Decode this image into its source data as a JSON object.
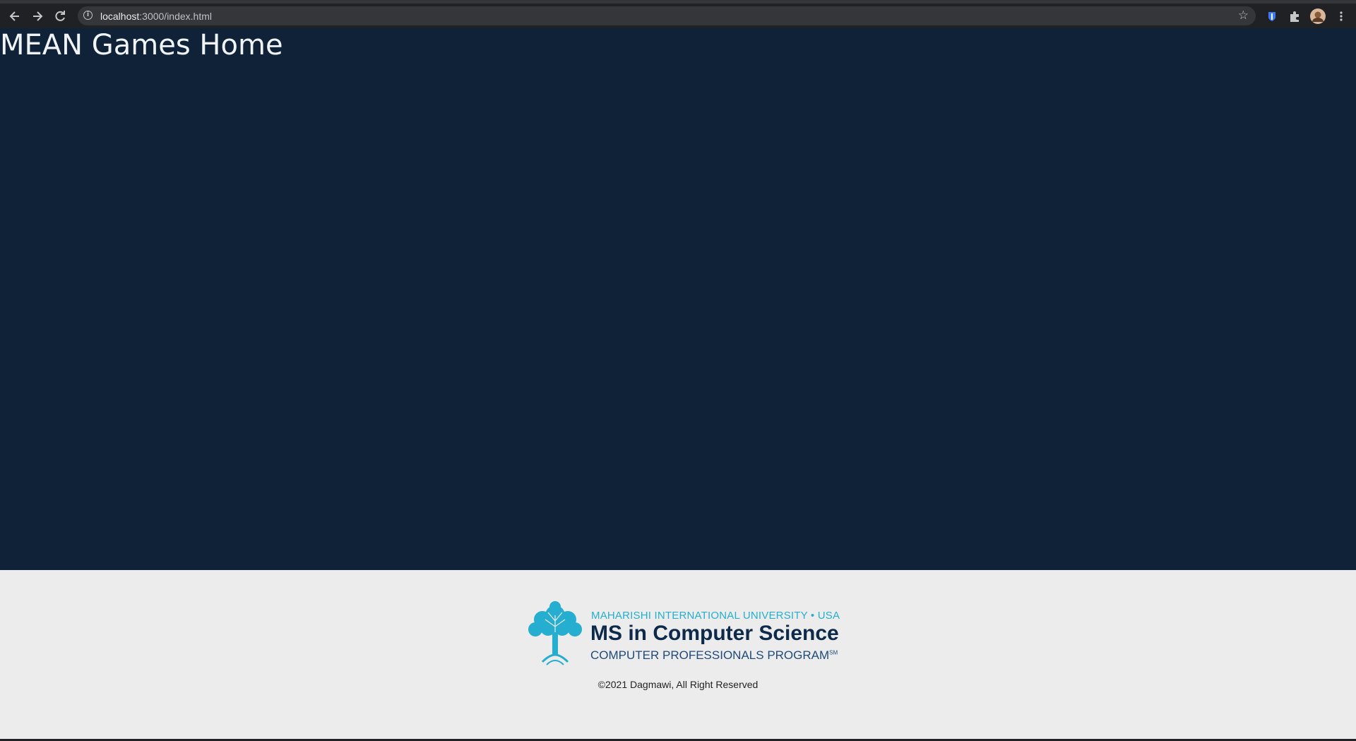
{
  "browser": {
    "url_host": "localhost",
    "url_path": ":3000/index.html",
    "icons": [
      "back-icon",
      "forward-icon",
      "reload-icon",
      "info-icon",
      "star-icon",
      "extension-shield-icon",
      "puzzle-icon",
      "avatar",
      "menu-icon"
    ]
  },
  "page": {
    "title": "MEAN Games Home",
    "background": "#0f2237"
  },
  "footer": {
    "logo_university": "MAHARISHI INTERNATIONAL UNIVERSITY • USA",
    "logo_degree": "MS in Computer Science",
    "logo_program": "COMPUTER PROFESSIONALS PROGRAM",
    "logo_program_mark": "SM",
    "copyright": "©2021 Dagmawi, All Right Reserved",
    "background": "#ececec",
    "accent": "#25aed0"
  }
}
